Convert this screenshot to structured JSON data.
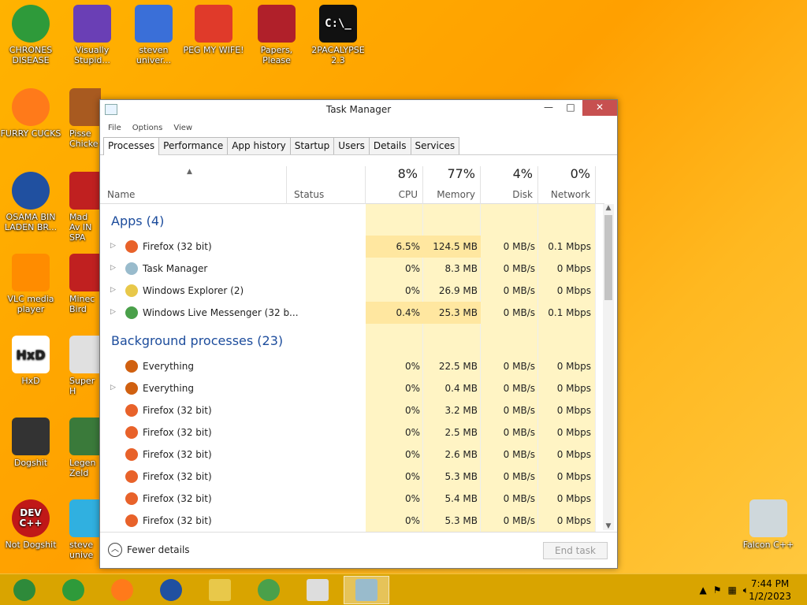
{
  "desktop": {
    "icons": [
      {
        "label": "CHRONES DISEASE",
        "icon": "chrome-icon"
      },
      {
        "label": "Visually Stupid...",
        "icon": "visual-studio-icon"
      },
      {
        "label": "steven univer...",
        "icon": "steven-universe-icon"
      },
      {
        "label": "PEG MY WIFE!",
        "icon": "peggle-icon"
      },
      {
        "label": "Papers, Please",
        "icon": "papers-please-icon"
      },
      {
        "label": "2PACALYPSE 2.3",
        "icon": "console-icon"
      },
      {
        "label": "FURRY CUCKS",
        "icon": "firefox-icon"
      },
      {
        "label": "Pisse Chicke",
        "icon": "game-icon"
      },
      {
        "label": "OSAMA BIN LADEN BR...",
        "icon": "obama-logo-icon"
      },
      {
        "label": "Mad Av IN SPA",
        "icon": "angry-birds-icon"
      },
      {
        "label": "VLC media player",
        "icon": "vlc-cone-icon"
      },
      {
        "label": "Minec Bird",
        "icon": "angry-bird-icon"
      },
      {
        "label": "HxD",
        "icon": "hxd-icon"
      },
      {
        "label": "Super H",
        "icon": "pixel-game-icon"
      },
      {
        "label": "Dogshit",
        "icon": "falcon-icon"
      },
      {
        "label": "Legen Zeld",
        "icon": "zelda-icon"
      },
      {
        "label": "Not Dogshit",
        "icon": "dev-cpp-icon"
      },
      {
        "label": "steve unive",
        "icon": "gem-icon"
      },
      {
        "label": "Falcon C++",
        "icon": "recycle-bin-icon"
      }
    ],
    "devcpp_text": "DEV C++",
    "hxd_text": "HxD",
    "console_text": "C:\\_"
  },
  "window": {
    "title": "Task Manager",
    "min": "—",
    "max": "□",
    "close": "✕",
    "menu": [
      "File",
      "Options",
      "View"
    ],
    "tabs": [
      "Processes",
      "Performance",
      "App history",
      "Startup",
      "Users",
      "Details",
      "Services"
    ],
    "active_tab": "Processes"
  },
  "columns": {
    "name": "Name",
    "status": "Status",
    "cpu": {
      "pct": "8%",
      "label": "CPU"
    },
    "memory": {
      "pct": "77%",
      "label": "Memory"
    },
    "disk": {
      "pct": "4%",
      "label": "Disk"
    },
    "network": {
      "pct": "0%",
      "label": "Network"
    }
  },
  "groups": {
    "apps": "Apps (4)",
    "background": "Background processes (23)"
  },
  "apps": [
    {
      "name": "Firefox (32 bit)",
      "cpu": "6.5%",
      "mem": "124.5 MB",
      "disk": "0 MB/s",
      "net": "0.1 Mbps",
      "icon": "firefox-icon",
      "expand": true
    },
    {
      "name": "Task Manager",
      "cpu": "0%",
      "mem": "8.3 MB",
      "disk": "0 MB/s",
      "net": "0 Mbps",
      "icon": "task-manager-icon",
      "expand": true
    },
    {
      "name": "Windows Explorer (2)",
      "cpu": "0%",
      "mem": "26.9 MB",
      "disk": "0 MB/s",
      "net": "0 Mbps",
      "icon": "folder-icon",
      "expand": true
    },
    {
      "name": "Windows Live Messenger (32 b...",
      "cpu": "0.4%",
      "mem": "25.3 MB",
      "disk": "0 MB/s",
      "net": "0.1 Mbps",
      "icon": "messenger-icon",
      "expand": true
    }
  ],
  "background": [
    {
      "name": "Everything",
      "cpu": "0%",
      "mem": "22.5 MB",
      "disk": "0 MB/s",
      "net": "0 Mbps",
      "icon": "search-magnifier-icon",
      "expand": false
    },
    {
      "name": "Everything",
      "cpu": "0%",
      "mem": "0.4 MB",
      "disk": "0 MB/s",
      "net": "0 Mbps",
      "icon": "search-magnifier-icon",
      "expand": true
    },
    {
      "name": "Firefox (32 bit)",
      "cpu": "0%",
      "mem": "3.2 MB",
      "disk": "0 MB/s",
      "net": "0 Mbps",
      "icon": "firefox-icon",
      "expand": false
    },
    {
      "name": "Firefox (32 bit)",
      "cpu": "0%",
      "mem": "2.5 MB",
      "disk": "0 MB/s",
      "net": "0 Mbps",
      "icon": "firefox-icon",
      "expand": false
    },
    {
      "name": "Firefox (32 bit)",
      "cpu": "0%",
      "mem": "2.6 MB",
      "disk": "0 MB/s",
      "net": "0 Mbps",
      "icon": "firefox-icon",
      "expand": false
    },
    {
      "name": "Firefox (32 bit)",
      "cpu": "0%",
      "mem": "5.3 MB",
      "disk": "0 MB/s",
      "net": "0 Mbps",
      "icon": "firefox-icon",
      "expand": false
    },
    {
      "name": "Firefox (32 bit)",
      "cpu": "0%",
      "mem": "5.4 MB",
      "disk": "0 MB/s",
      "net": "0 Mbps",
      "icon": "firefox-icon",
      "expand": false
    },
    {
      "name": "Firefox (32 bit)",
      "cpu": "0%",
      "mem": "5.3 MB",
      "disk": "0 MB/s",
      "net": "0 Mbps",
      "icon": "firefox-icon",
      "expand": false
    }
  ],
  "footer": {
    "fewer_details": "Fewer details",
    "end_task": "End task"
  },
  "taskbar": {
    "buttons": [
      "chrome-alt-icon",
      "chrome-icon",
      "firefox-icon",
      "obama-logo-icon",
      "file-explorer-icon",
      "messenger-icon",
      "app-icon",
      "task-manager-icon"
    ],
    "active": "task-manager-icon",
    "time": "7:44 PM",
    "date": "1/2/2023"
  },
  "colors": {
    "group_header": "#1c4c9c",
    "heat_light": "#fff4c4",
    "heat_strong": "#ffe7a0",
    "desktop_bg": "#ffa000",
    "close_button": "#c75050"
  }
}
